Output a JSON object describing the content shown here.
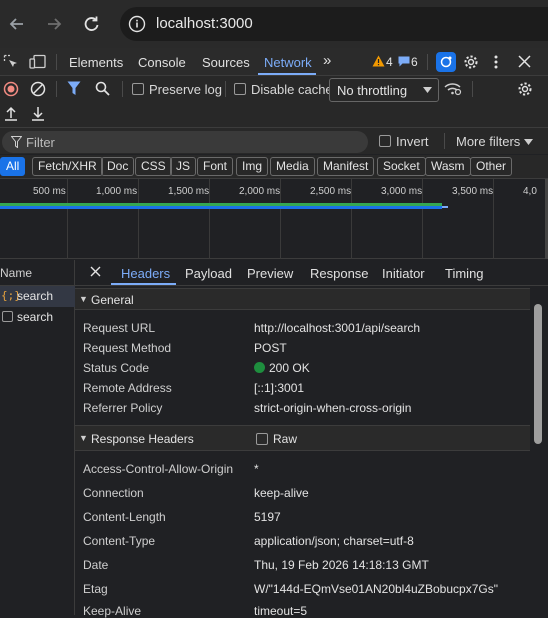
{
  "browser": {
    "url": "localhost:3000"
  },
  "devtools": {
    "tabs": [
      "Elements",
      "Console",
      "Sources",
      "Network"
    ],
    "active_tab": "Network",
    "warnings_count": "4",
    "messages_count": "6"
  },
  "toolbar": {
    "preserve_log_label": "Preserve log",
    "disable_cache_label": "Disable cache",
    "throttling_value": "No throttling"
  },
  "filter": {
    "placeholder": "Filter",
    "invert_label": "Invert",
    "more_filters_label": "More filters"
  },
  "type_filters": [
    "All",
    "Fetch/XHR",
    "Doc",
    "CSS",
    "JS",
    "Font",
    "Img",
    "Media",
    "Manifest",
    "Socket",
    "Wasm",
    "Other"
  ],
  "timeline": {
    "ticks": [
      "500 ms",
      "1,000 ms",
      "1,500 ms",
      "2,000 ms",
      "2,500 ms",
      "3,000 ms",
      "3,500 ms",
      "4,0"
    ]
  },
  "request_list": {
    "header": "Name",
    "items": [
      {
        "name": "search",
        "icon": "xhr-icon",
        "selected": true
      },
      {
        "name": "search",
        "icon": "checkbox-icon",
        "selected": false
      }
    ]
  },
  "details": {
    "tabs": [
      "Headers",
      "Payload",
      "Preview",
      "Response",
      "Initiator",
      "Timing"
    ],
    "active_tab": "Headers",
    "general": {
      "title": "General",
      "rows": [
        {
          "key": "Request URL",
          "value": "http://localhost:3001/api/search"
        },
        {
          "key": "Request Method",
          "value": "POST"
        },
        {
          "key": "Status Code",
          "value": "200 OK"
        },
        {
          "key": "Remote Address",
          "value": "[::1]:3001"
        },
        {
          "key": "Referrer Policy",
          "value": "strict-origin-when-cross-origin"
        }
      ]
    },
    "response_headers": {
      "title": "Response Headers",
      "raw_label": "Raw",
      "rows": [
        {
          "key": "Access-Control-Allow-Origin",
          "value": "*"
        },
        {
          "key": "Connection",
          "value": "keep-alive"
        },
        {
          "key": "Content-Length",
          "value": "5197"
        },
        {
          "key": "Content-Type",
          "value": "application/json; charset=utf-8"
        },
        {
          "key": "Date",
          "value": "Thu, 19 Feb 2026 14:18:13 GMT"
        },
        {
          "key": "Etag",
          "value": "W/\"144d-EQmVse01AN20bl4uZBobucpx7Gs\""
        },
        {
          "key": "Keep-Alive",
          "value": "timeout=5"
        }
      ]
    }
  },
  "colors": {
    "accent": "#7cacf8",
    "status_ok": "#1e8e3e",
    "record": "#f28b82",
    "warning": "#f29900",
    "waterfall": "#34a853"
  }
}
